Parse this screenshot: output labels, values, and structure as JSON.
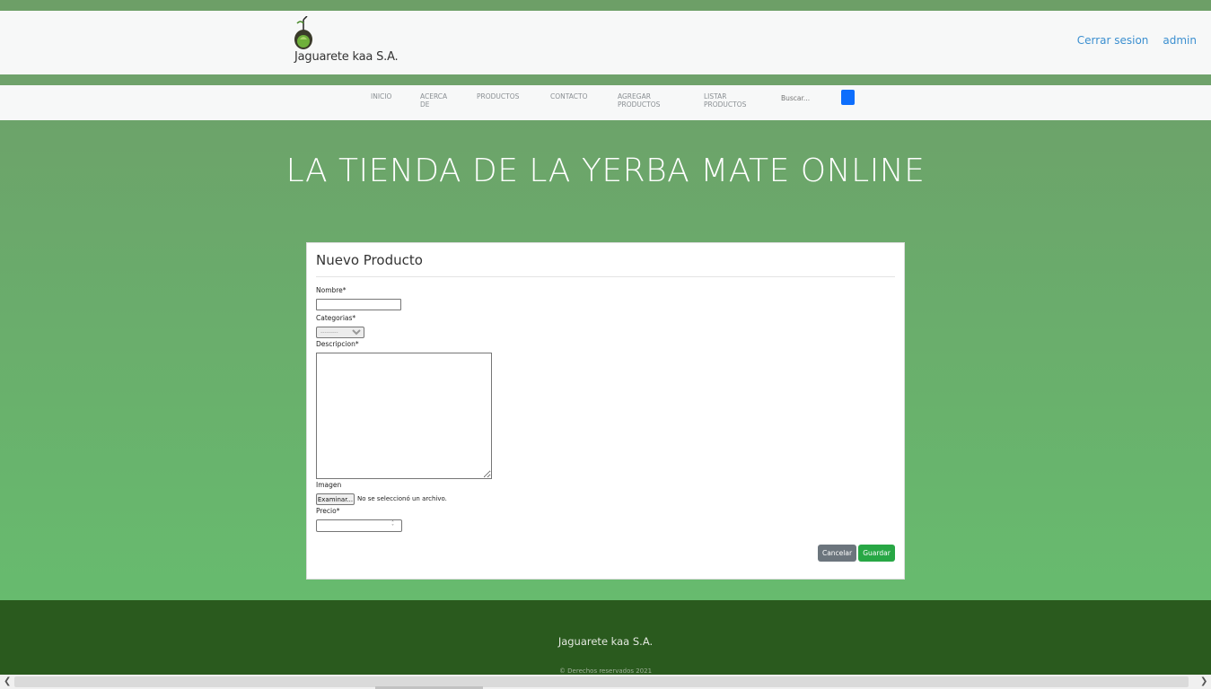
{
  "header": {
    "brand": "Jaguarete kaa S.A.",
    "logo_icon": "yerba-mate-gourd-icon",
    "links": [
      "Cerrar sesion",
      "admin"
    ]
  },
  "nav": {
    "items": [
      "INICIO",
      "ACERCA DE",
      "PRODUCTOS",
      "CONTACTO",
      "AGREGAR PRODUCTOS",
      "LISTAR PRODUCTOS"
    ],
    "search_placeholder": "Buscar...",
    "search_button_color": "#0d6efd"
  },
  "hero": {
    "title": "LA TIENDA DE LA YERBA MATE ONLINE"
  },
  "form": {
    "title": "Nuevo Producto",
    "nombre_label": "Nombre*",
    "categorias_label": "Categorias*",
    "categorias_selected": "---------",
    "descripcion_label": "Descripcion*",
    "imagen_label": "Imagen",
    "file_button": "Examinar...",
    "file_status": "No se seleccionó un archivo.",
    "precio_label": "Precio*",
    "cancel_label": "Cancelar",
    "save_label": "Guardar"
  },
  "footer": {
    "brand": "Jaguarete kaa S.A.",
    "copyright": "© Derechos reservados 2021"
  },
  "colors": {
    "hero_top": "#6ca36a",
    "hero_bottom": "#67bb6e",
    "footer": "#2a5a1e",
    "link": "#3b8fd0",
    "save": "#28a745",
    "cancel": "#6c757d"
  }
}
